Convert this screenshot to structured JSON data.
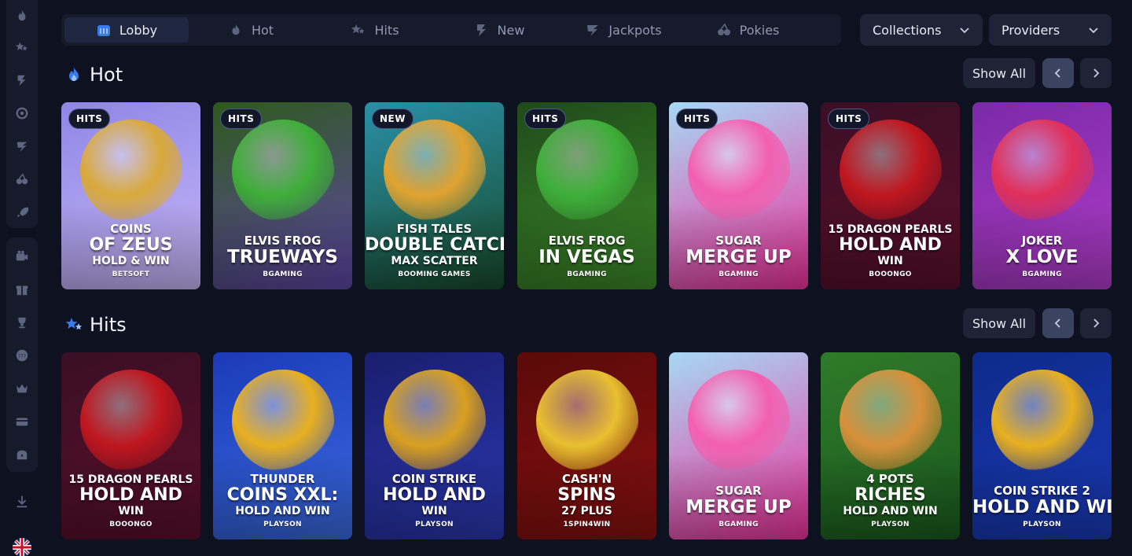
{
  "nav": {
    "tabs": [
      {
        "label": "Lobby",
        "icon": "lobby-icon",
        "active": true
      },
      {
        "label": "Hot",
        "icon": "flame-icon",
        "active": false
      },
      {
        "label": "Hits",
        "icon": "stars-icon",
        "active": false
      },
      {
        "label": "New",
        "icon": "new-icon",
        "active": false
      },
      {
        "label": "Jackpots",
        "icon": "jackpot-icon",
        "active": false
      },
      {
        "label": "Pokies",
        "icon": "cherries-icon",
        "active": false
      }
    ],
    "collections_label": "Collections",
    "providers_label": "Providers"
  },
  "sidebar": {
    "group1": [
      "flame-icon",
      "stars-icon",
      "new-icon",
      "target-icon",
      "jackpot-icon",
      "cherries-icon",
      "rocket-icon"
    ],
    "group2": [
      "camera-icon",
      "gift-icon",
      "trophy-icon",
      "slot-icon",
      "crown-icon",
      "card-icon",
      "chest-icon"
    ],
    "download_icon": "download-icon",
    "language_flag": "uk-flag-icon"
  },
  "sections": [
    {
      "title": "Hot",
      "icon": "flame-icon",
      "show_all": "Show All",
      "games": [
        {
          "badge": "HITS",
          "lines": [
            "COINS",
            "OF ZEUS",
            "HOLD & WIN"
          ],
          "provider": "BETSOFT",
          "bg": [
            "#8f86e6",
            "#c7b7f7"
          ],
          "art": "#d9a93a"
        },
        {
          "badge": "HITS",
          "lines": [
            "ELVIS FROG",
            "TRUEWAYS"
          ],
          "provider": "BGAMING",
          "bg": [
            "#2e5a1c",
            "#5f46a6"
          ],
          "art": "#3fae3a"
        },
        {
          "badge": "NEW",
          "lines": [
            "FISH TALES",
            "DOUBLE CATCH",
            "MAX SCATTER"
          ],
          "provider": "BOOMING GAMES",
          "bg": [
            "#2a8fa8",
            "#174a2a"
          ],
          "art": "#e0a330"
        },
        {
          "badge": "HITS",
          "lines": [
            "ELVIS FROG",
            "IN VEGAS"
          ],
          "provider": "BGAMING",
          "bg": [
            "#1f4a1a",
            "#3c8a2a"
          ],
          "art": "#3fae3a"
        },
        {
          "badge": "HITS",
          "lines": [
            "SUGAR",
            "MERGE UP"
          ],
          "provider": "BGAMING",
          "bg": [
            "#a6d9f5",
            "#f0309c"
          ],
          "art": "#f35fb0"
        },
        {
          "badge": "HITS",
          "lines": [
            "15 DRAGON PEARLS",
            "HOLD AND",
            "WIN"
          ],
          "provider": "BOOONGO",
          "bg": [
            "#3a0f25",
            "#5a0f2a"
          ],
          "art": "#c0161e"
        },
        {
          "badge": "",
          "lines": [
            "JOKER",
            "X LOVE"
          ],
          "provider": "BGAMING",
          "bg": [
            "#7a2aa8",
            "#b03cc8"
          ],
          "art": "#e0305a"
        }
      ]
    },
    {
      "title": "Hits",
      "icon": "stars-icon",
      "show_all": "Show All",
      "games": [
        {
          "badge": "",
          "lines": [
            "15 DRAGON PEARLS",
            "HOLD AND",
            "WIN"
          ],
          "provider": "BOOONGO",
          "bg": [
            "#3a0f25",
            "#5a0f2a"
          ],
          "art": "#c0161e"
        },
        {
          "badge": "",
          "lines": [
            "THUNDER",
            "COINS XXL:",
            "HOLD AND WIN"
          ],
          "provider": "PLAYSON",
          "bg": [
            "#1c3ab8",
            "#3a6ae0"
          ],
          "art": "#e8b020"
        },
        {
          "badge": "",
          "lines": [
            "COIN STRIKE",
            "HOLD AND",
            "WIN"
          ],
          "provider": "PLAYSON",
          "bg": [
            "#1a1e6e",
            "#2a38b0"
          ],
          "art": "#d9a020"
        },
        {
          "badge": "",
          "lines": [
            "CASH'N",
            "SPINS",
            "27 PLUS"
          ],
          "provider": "1SPIN4WIN",
          "bg": [
            "#5a0a0a",
            "#8a1010"
          ],
          "art": "#e8c030"
        },
        {
          "badge": "",
          "lines": [
            "SUGAR",
            "MERGE UP"
          ],
          "provider": "BGAMING",
          "bg": [
            "#a6d9f5",
            "#f0309c"
          ],
          "art": "#f35fb0"
        },
        {
          "badge": "",
          "lines": [
            "4 POTS",
            "RICHES",
            "HOLD AND WIN"
          ],
          "provider": "PLAYSON",
          "bg": [
            "#2f7a2a",
            "#1a5a1e"
          ],
          "art": "#d8903a"
        },
        {
          "badge": "",
          "lines": [
            "COIN STRIKE 2",
            "HOLD AND WIN"
          ],
          "provider": "PLAYSON",
          "bg": [
            "#0e2a8a",
            "#1a3ab8"
          ],
          "art": "#e8b020"
        }
      ]
    }
  ]
}
